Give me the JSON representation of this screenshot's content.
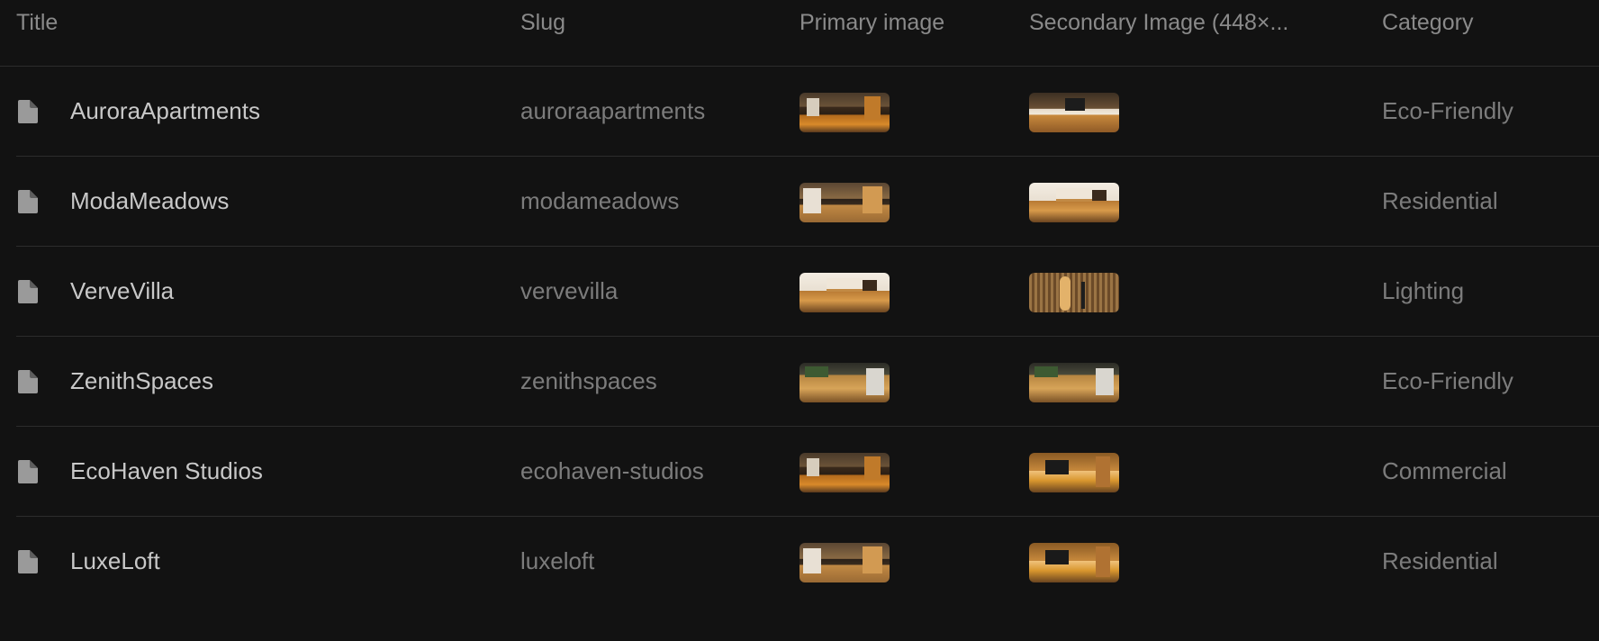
{
  "columns": {
    "title": "Title",
    "slug": "Slug",
    "primary_image": "Primary image",
    "secondary_image": "Secondary Image (448×...",
    "category": "Category"
  },
  "rows": [
    {
      "icon": "document-icon",
      "title": "AuroraApartments",
      "slug": "auroraapartments",
      "primary_image": "thumbnail",
      "secondary_image": "thumbnail",
      "category": "Eco-Friendly"
    },
    {
      "icon": "document-icon",
      "title": "ModaMeadows",
      "slug": "modameadows",
      "primary_image": "thumbnail",
      "secondary_image": "thumbnail",
      "category": "Residential"
    },
    {
      "icon": "document-icon",
      "title": "VerveVilla",
      "slug": "vervevilla",
      "primary_image": "thumbnail",
      "secondary_image": "thumbnail",
      "category": "Lighting"
    },
    {
      "icon": "document-icon",
      "title": "ZenithSpaces",
      "slug": "zenithspaces",
      "primary_image": "thumbnail",
      "secondary_image": "thumbnail",
      "category": "Eco-Friendly"
    },
    {
      "icon": "document-icon",
      "title": "EcoHaven Studios",
      "slug": "ecohaven-studios",
      "primary_image": "thumbnail",
      "secondary_image": "thumbnail",
      "category": "Commercial"
    },
    {
      "icon": "document-icon",
      "title": "LuxeLoft",
      "slug": "luxeloft",
      "primary_image": "thumbnail",
      "secondary_image": "thumbnail",
      "category": "Residential"
    }
  ],
  "colors": {
    "background": "#121212",
    "divider": "#2c2c2c",
    "title_text": "#c8c8c8",
    "muted_text": "#7c7c7c",
    "header_text": "#8a8a8a",
    "icon": "#9a9a9a"
  }
}
